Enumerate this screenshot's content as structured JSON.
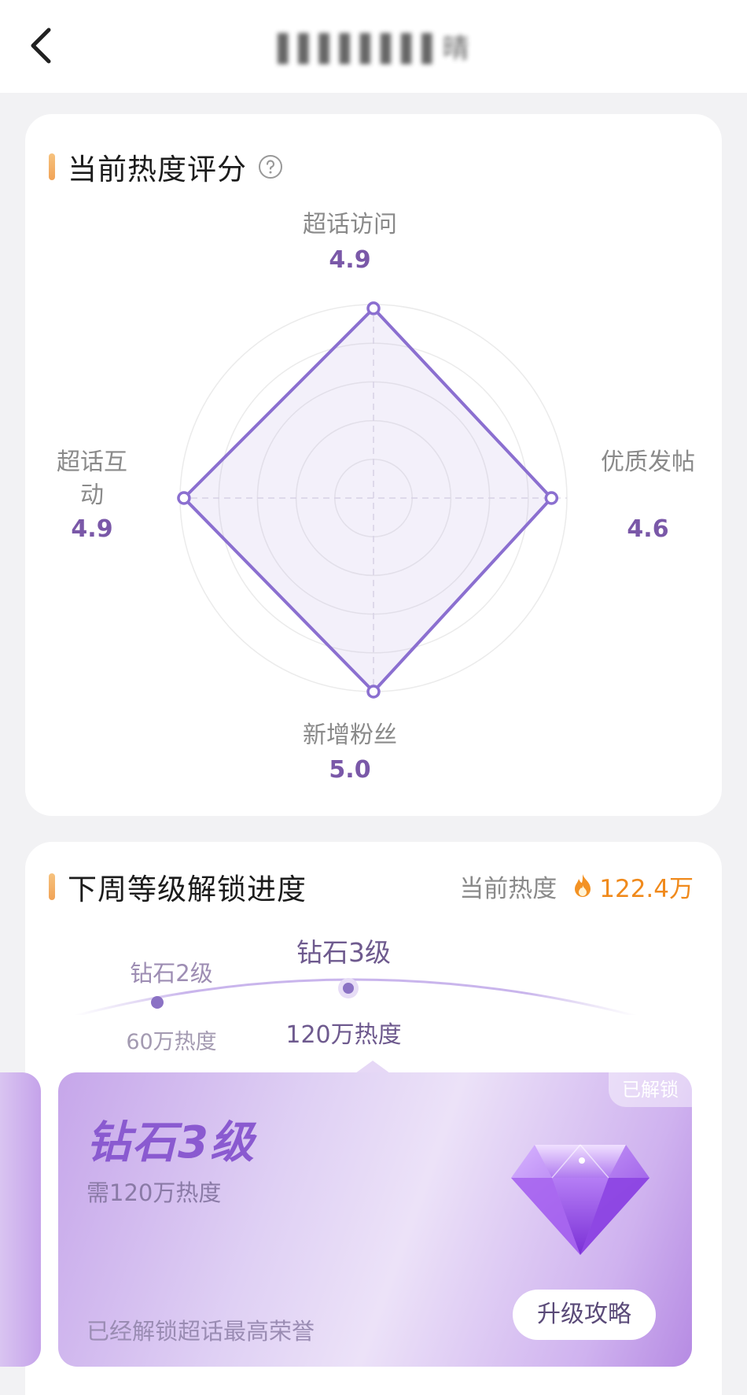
{
  "nav": {
    "title": "▌▌▌▌▌▌▌▌晴"
  },
  "score_section": {
    "title": "当前热度评分",
    "axes": [
      {
        "name": "超话访问",
        "value": "4.9"
      },
      {
        "name": "优质发帖",
        "value": "4.6"
      },
      {
        "name": "新增粉丝",
        "value": "5.0"
      },
      {
        "name": "超话互动",
        "value": "4.9"
      }
    ],
    "accent": "#8b6fd0"
  },
  "chart_data": {
    "type": "radar",
    "categories": [
      "超话访问",
      "优质发帖",
      "新增粉丝",
      "超话互动"
    ],
    "values": [
      4.9,
      4.6,
      5.0,
      4.9
    ],
    "ylim": [
      0,
      5
    ]
  },
  "progress_section": {
    "title": "下周等级解锁进度",
    "heat_label": "当前热度",
    "heat_value": "122.4万",
    "levels": [
      {
        "name": "钻石2级",
        "requirement": "60万热度"
      },
      {
        "name": "钻石3级",
        "requirement": "120万热度"
      }
    ],
    "card": {
      "badge": "已解锁",
      "title": "钻石3级",
      "need": "需120万热度",
      "footer": "已经解锁超话最高荣誉",
      "button": "升级攻略"
    }
  }
}
